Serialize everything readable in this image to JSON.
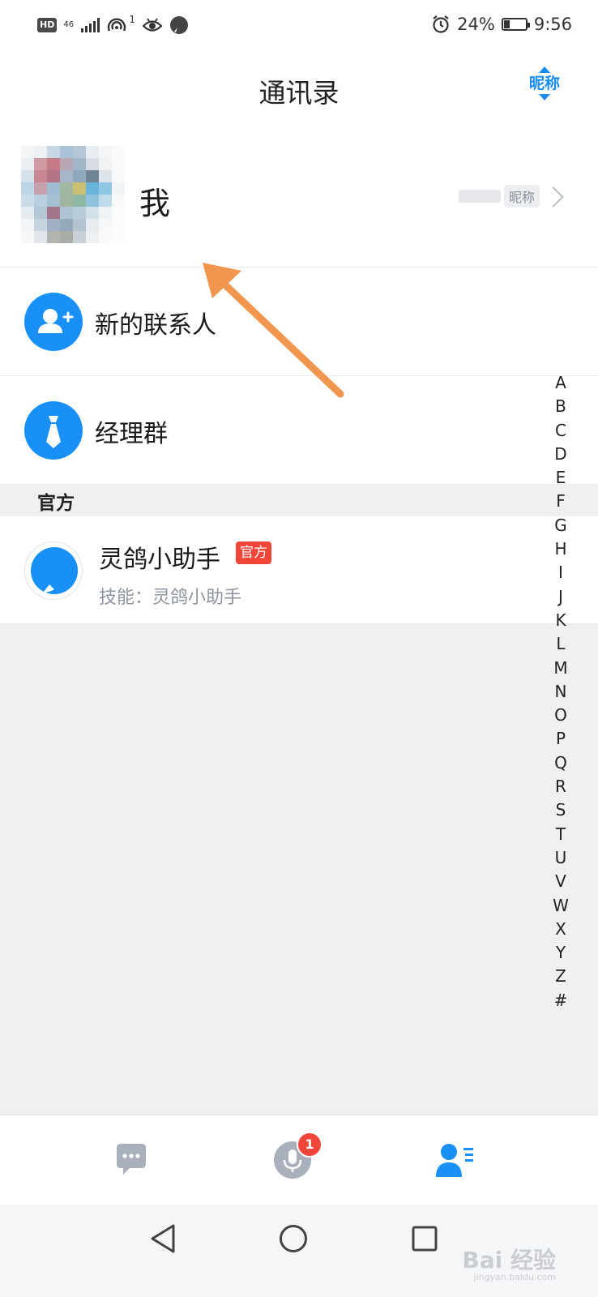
{
  "status_bar": {
    "hd": "HD",
    "network": "46",
    "notif_count": "1",
    "battery": "24%",
    "time": "9:56"
  },
  "header": {
    "title": "通讯录",
    "sort_label": "昵称"
  },
  "me": {
    "name": "我",
    "nickname_tag": "昵称"
  },
  "entries": [
    {
      "label": "新的联系人",
      "icon": "add-contact-icon"
    },
    {
      "label": "经理群",
      "icon": "tie-icon"
    }
  ],
  "section": {
    "title": "官方"
  },
  "assistant": {
    "name": "灵鸽小助手",
    "tag": "官方",
    "skill": "技能：灵鸽小助手"
  },
  "alpha_index": [
    "A",
    "B",
    "C",
    "D",
    "E",
    "F",
    "G",
    "H",
    "I",
    "J",
    "K",
    "L",
    "M",
    "N",
    "O",
    "P",
    "Q",
    "R",
    "S",
    "T",
    "U",
    "V",
    "W",
    "X",
    "Y",
    "Z",
    "#"
  ],
  "bottom_nav": {
    "tabs": [
      {
        "name": "messages",
        "icon": "chat-bubble-icon",
        "active": false
      },
      {
        "name": "voice",
        "icon": "microphone-icon",
        "active": false,
        "badge": "1"
      },
      {
        "name": "contacts",
        "icon": "contacts-icon",
        "active": true
      }
    ]
  },
  "watermark": {
    "main": "Bai 经验",
    "sub": "jingyan.baidu.com"
  },
  "colors": {
    "accent": "#1890f7",
    "badge_red": "#f2453a",
    "arrow_orange": "#f0964f",
    "background": "#eff0f2"
  }
}
